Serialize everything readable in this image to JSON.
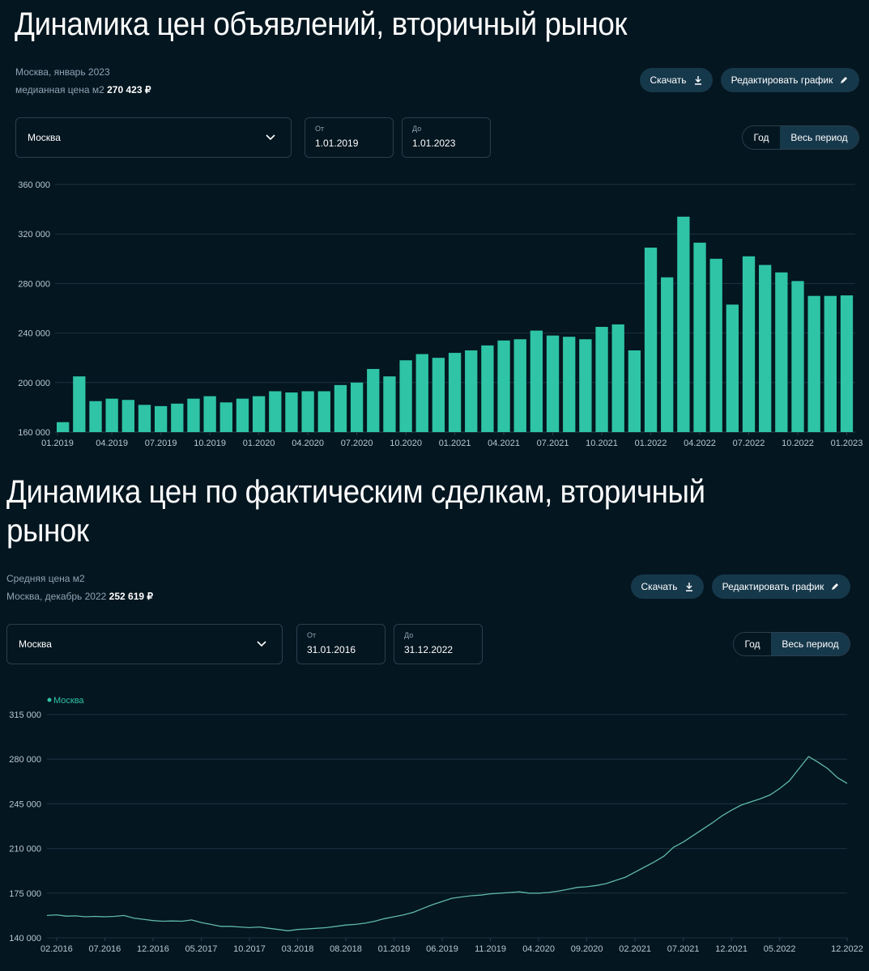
{
  "section1": {
    "title": "Динамика цен объявлений, вторичный рынок",
    "meta_line1": "Москва, январь 2023",
    "meta_label": "медианная цена м2",
    "meta_value": "270 423 ₽",
    "download_label": "Скачать",
    "edit_label": "Редактировать график",
    "region_select": "Москва",
    "date_from_label": "От",
    "date_from_value": "1.01.2019",
    "date_to_label": "До",
    "date_to_value": "1.01.2023",
    "toggle_year": "Год",
    "toggle_all": "Весь период",
    "active_toggle": "Весь период"
  },
  "section2": {
    "title_line1": "Динамика цен по фактическим сделкам, вторичный",
    "title_line2": "рынок",
    "meta_line1": "Средняя цена м2",
    "meta_label": "Москва, декабрь 2022",
    "meta_value": "252 619 ₽",
    "download_label": "Скачать",
    "edit_label": "Редактировать график",
    "region_select": "Москва",
    "date_from_label": "От",
    "date_from_value": "31.01.2016",
    "date_to_label": "До",
    "date_to_value": "31.12.2022",
    "toggle_year": "Год",
    "toggle_all": "Весь период",
    "active_toggle": "Весь период"
  },
  "colors": {
    "background": "#041620",
    "bar": "#2ec4a5",
    "line": "#5fb8a8",
    "legend_dot": "#2ec4a5",
    "grid": "#1d3340",
    "axis_text": "#b9c8d3",
    "button_bg": "#16384b"
  },
  "chart_data": [
    {
      "type": "bar",
      "title": "Динамика цен объявлений, вторичный рынок",
      "xlabel": "",
      "ylabel": "",
      "ylim": [
        160000,
        360000
      ],
      "yticks": [
        160000,
        200000,
        240000,
        280000,
        320000,
        360000
      ],
      "ytick_labels": [
        "160 000",
        "200 000",
        "240 000",
        "280 000",
        "320 000",
        "360 000"
      ],
      "grid": true,
      "xtick_labels": [
        "01.2019",
        "04.2019",
        "07.2019",
        "10.2019",
        "01.2020",
        "04.2020",
        "07.2020",
        "10.2020",
        "01.2021",
        "04.2021",
        "07.2021",
        "10.2021",
        "01.2022",
        "04.2022",
        "07.2022",
        "10.2022",
        "01.2023"
      ],
      "categories": [
        "01.2019",
        "02.2019",
        "03.2019",
        "04.2019",
        "05.2019",
        "06.2019",
        "07.2019",
        "08.2019",
        "09.2019",
        "10.2019",
        "11.2019",
        "12.2019",
        "01.2020",
        "02.2020",
        "03.2020",
        "04.2020",
        "05.2020",
        "06.2020",
        "07.2020",
        "08.2020",
        "09.2020",
        "10.2020",
        "11.2020",
        "12.2020",
        "01.2021",
        "02.2021",
        "03.2021",
        "04.2021",
        "05.2021",
        "06.2021",
        "07.2021",
        "08.2021",
        "09.2021",
        "10.2021",
        "11.2021",
        "12.2021",
        "01.2022",
        "02.2022",
        "03.2022",
        "04.2022",
        "05.2022",
        "06.2022",
        "07.2022",
        "08.2022",
        "09.2022",
        "10.2022",
        "11.2022",
        "12.2022",
        "01.2023"
      ],
      "values": [
        168000,
        205000,
        185000,
        187000,
        186000,
        182000,
        181000,
        183000,
        187000,
        189000,
        184000,
        187000,
        189000,
        193000,
        192000,
        193000,
        193000,
        198000,
        200000,
        211000,
        205000,
        218000,
        223000,
        220000,
        224000,
        226000,
        230000,
        234000,
        235000,
        242000,
        238000,
        237000,
        235000,
        245000,
        247000,
        226000,
        309000,
        285000,
        334000,
        313000,
        300000,
        263000,
        302000,
        295000,
        289000,
        282000,
        270000,
        270000,
        270423
      ]
    },
    {
      "type": "line",
      "title": "Динамика цен по фактическим сделкам, вторичный рынок",
      "xlabel": "",
      "ylabel": "",
      "ylim": [
        140000,
        315000
      ],
      "yticks": [
        140000,
        175000,
        210000,
        245000,
        280000,
        315000
      ],
      "ytick_labels": [
        "140 000",
        "175 000",
        "210 000",
        "245 000",
        "280 000",
        "315 000"
      ],
      "grid": true,
      "legend": {
        "entries": [
          "Москва"
        ],
        "placement": "top-left"
      },
      "xtick_labels": [
        "02.2016",
        "07.2016",
        "12.2016",
        "05.2017",
        "10.2017",
        "03.2018",
        "08.2018",
        "01.2019",
        "06.2019",
        "11.2019",
        "04.2020",
        "09.2020",
        "02.2021",
        "07.2021",
        "12.2021",
        "05.2022",
        "12.2022"
      ],
      "x_start": "01.2016",
      "x_end": "12.2022",
      "series": [
        {
          "name": "Москва",
          "values": [
            157500,
            158000,
            157000,
            157200,
            156500,
            156800,
            156500,
            156800,
            157500,
            155500,
            154500,
            153500,
            153000,
            153200,
            153000,
            154000,
            152000,
            150500,
            149000,
            149000,
            148500,
            148000,
            148500,
            147500,
            146500,
            145500,
            146500,
            147000,
            147500,
            148000,
            149000,
            150000,
            150500,
            151500,
            153000,
            155000,
            156500,
            158000,
            160000,
            163000,
            166000,
            168500,
            171000,
            172000,
            173000,
            173500,
            174500,
            175000,
            175500,
            176000,
            175000,
            175000,
            175500,
            176500,
            178000,
            179500,
            180000,
            181000,
            182500,
            185000,
            187500,
            191500,
            195500,
            199500,
            204000,
            211000,
            215000,
            220000,
            225000,
            230000,
            235500,
            240000,
            244000,
            246500,
            249000,
            252000,
            257000,
            263000,
            272500,
            282000,
            277500,
            272500,
            265500,
            261000
          ]
        }
      ]
    }
  ]
}
